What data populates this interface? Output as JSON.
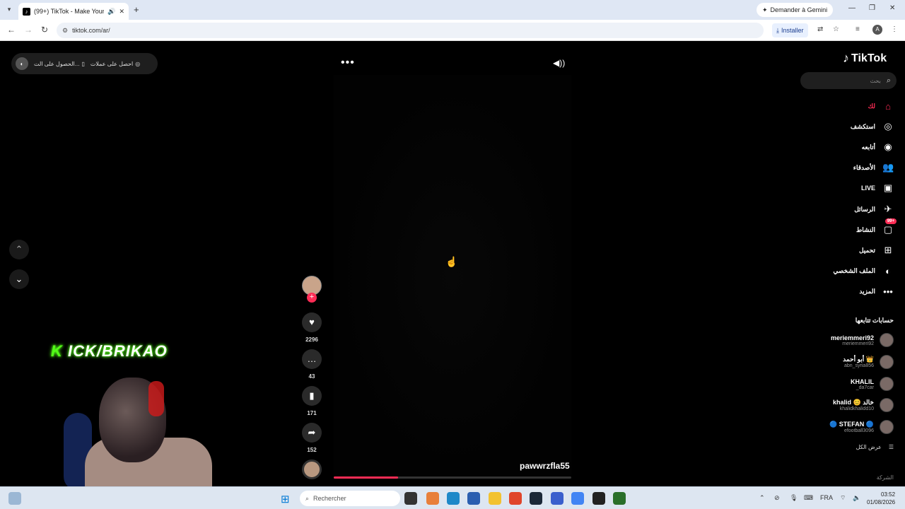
{
  "browser": {
    "tab_title": "(99+) TikTok - Make Your D…",
    "new_tab": "+",
    "gemini_label": "Demander à Gemini",
    "url": "tiktok.com/ar/",
    "install_label": "Installer",
    "profile_initial": "A"
  },
  "page": {
    "pill_get_coins": "احصل على عملات",
    "pill_get": "الحصول على الت...",
    "more_dots": "•••",
    "video_username": "pawwrzfla55",
    "progress_fraction": 0.27,
    "nav_up": "⌃",
    "nav_down": "⌄"
  },
  "actions": {
    "likes": "2296",
    "comments": "43",
    "saves": "171",
    "shares": "152"
  },
  "overlay": {
    "kick_prefix": "K",
    "kick_rest": " ICK/BRIKAO"
  },
  "sidebar": {
    "logo": "TikTok",
    "search_placeholder": "بحث",
    "items": [
      {
        "label": "لك",
        "icon": "⌂",
        "active": true
      },
      {
        "label": "استكشف",
        "icon": "◎"
      },
      {
        "label": "أتابعه",
        "icon": "◉"
      },
      {
        "label": "الأصدقاء",
        "icon": "👥"
      },
      {
        "label": "LIVE",
        "icon": "▣"
      },
      {
        "label": "الرسائل",
        "icon": "✈"
      },
      {
        "label": "النشاط",
        "icon": "▢",
        "badge": "99+"
      },
      {
        "label": "تحميل",
        "icon": "⊞"
      },
      {
        "label": "الملف الشخصي",
        "icon": "◐"
      },
      {
        "label": "المزيد",
        "icon": "•••"
      }
    ],
    "following_title": "حسابات تتابعها",
    "accounts": [
      {
        "nick": "meriemmeri92",
        "user": "meriemmeri92"
      },
      {
        "nick": "أبو أحمد 👑",
        "user": "abn_syria856"
      },
      {
        "nick": "KHALIL",
        "user": "_da7car"
      },
      {
        "nick": "khalid 😊 خالد",
        "user": "khalidkhalidd10"
      },
      {
        "nick": "🔵 STEFAN 🔵",
        "user": "efootball3096"
      }
    ],
    "see_all": "عرض الكل",
    "company": "الشركة"
  },
  "taskbar": {
    "search_label": "Rechercher",
    "lang": "FRA",
    "time": "03:52",
    "date": "01/08/2026"
  },
  "colors": {
    "accent": "#fe2c55",
    "kick_green": "#53fc18"
  }
}
